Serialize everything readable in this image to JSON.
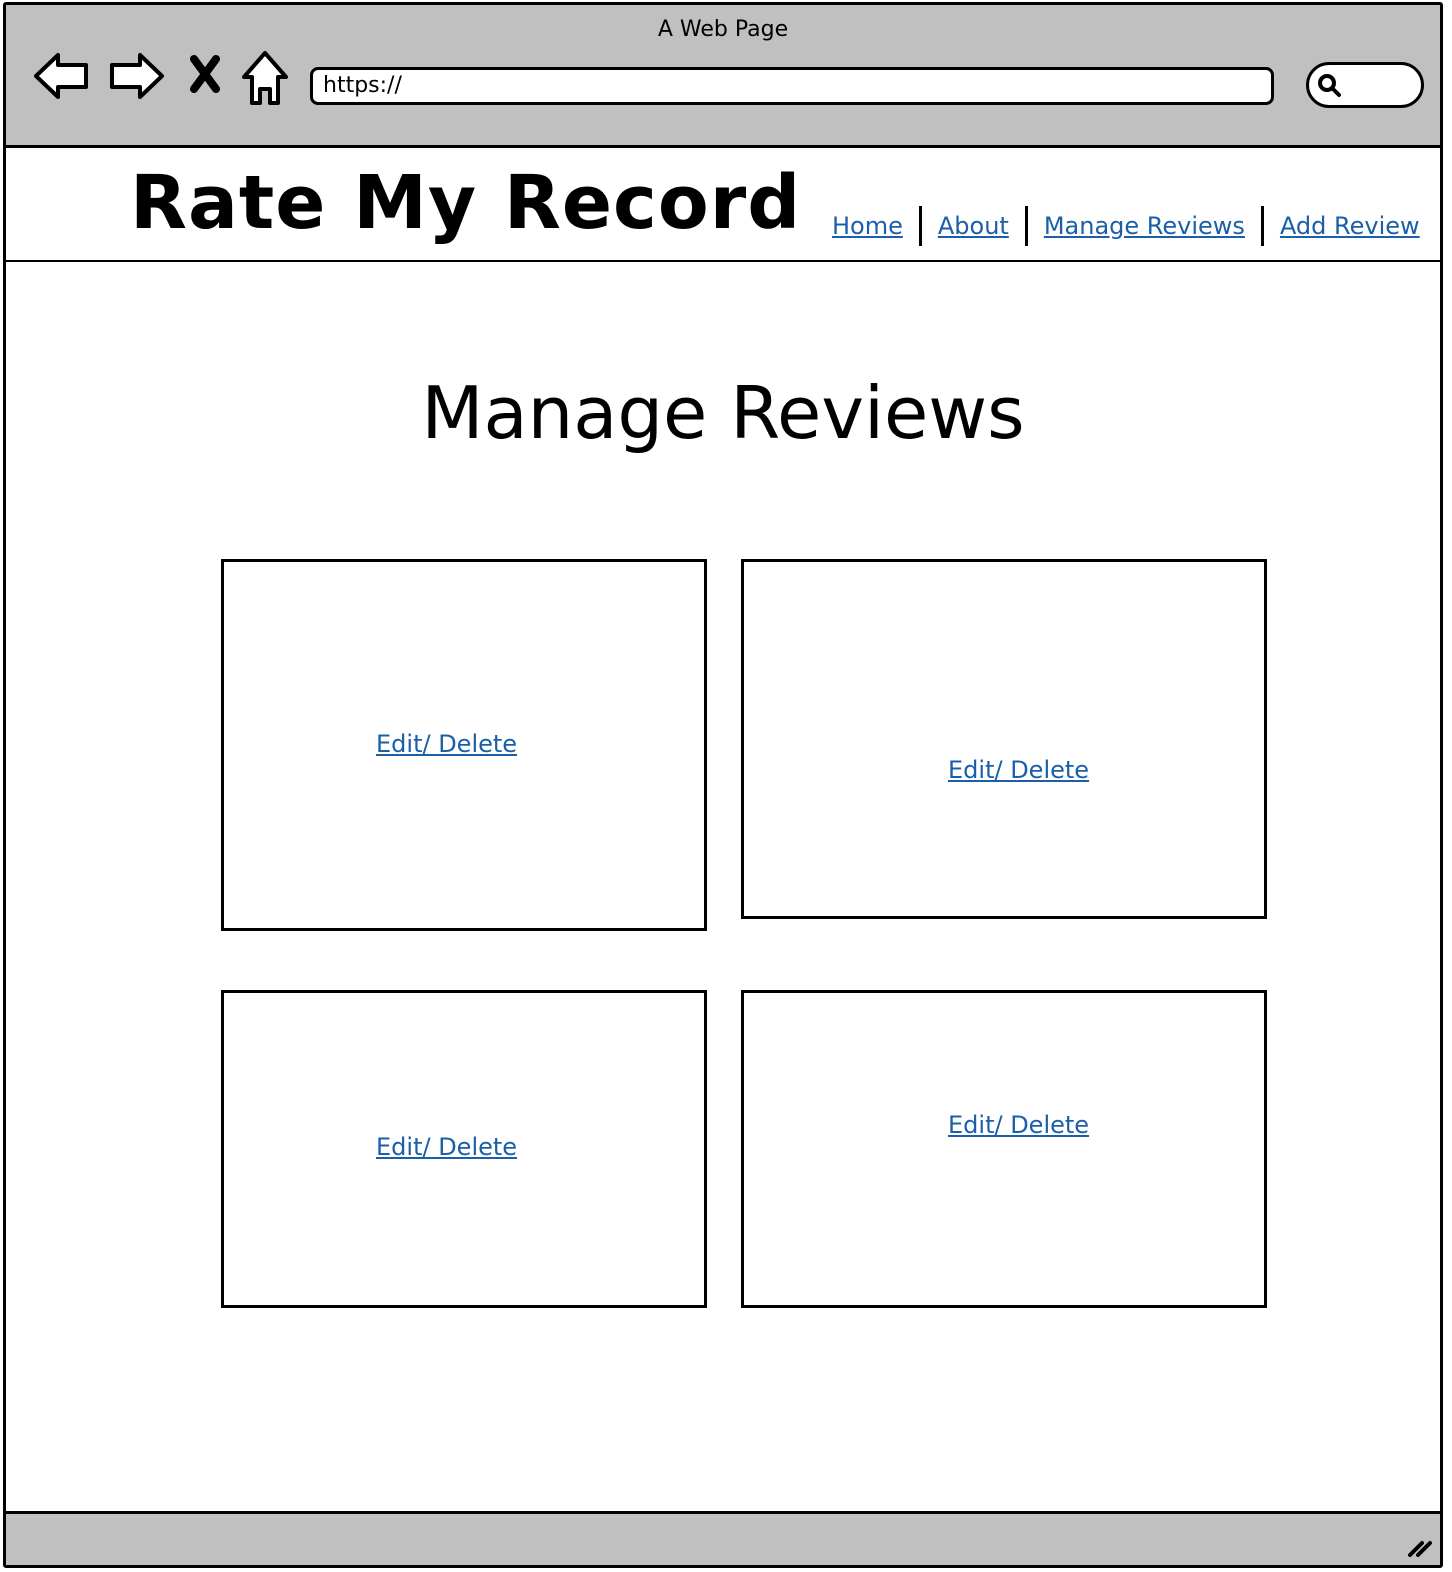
{
  "window": {
    "title": "A Web Page",
    "url": "https://"
  },
  "site": {
    "logo": "Rate My Record",
    "nav": [
      {
        "label": "Home"
      },
      {
        "label": "About"
      },
      {
        "label": "Manage Reviews"
      },
      {
        "label": "Add Review"
      }
    ]
  },
  "main": {
    "title": "Manage Reviews",
    "cards": [
      {
        "link": "Edit/ Delete"
      },
      {
        "link": "Edit/ Delete"
      },
      {
        "link": "Edit/ Delete"
      },
      {
        "link": "Edit/ Delete"
      }
    ]
  },
  "icons": {
    "back": "back-arrow-icon",
    "forward": "forward-arrow-icon",
    "stop": "close-icon",
    "home": "home-icon",
    "search": "search-icon",
    "resize": "resize-grip-icon"
  },
  "colors": {
    "chrome": "#c0c0c0",
    "link": "#1a5fa8"
  }
}
